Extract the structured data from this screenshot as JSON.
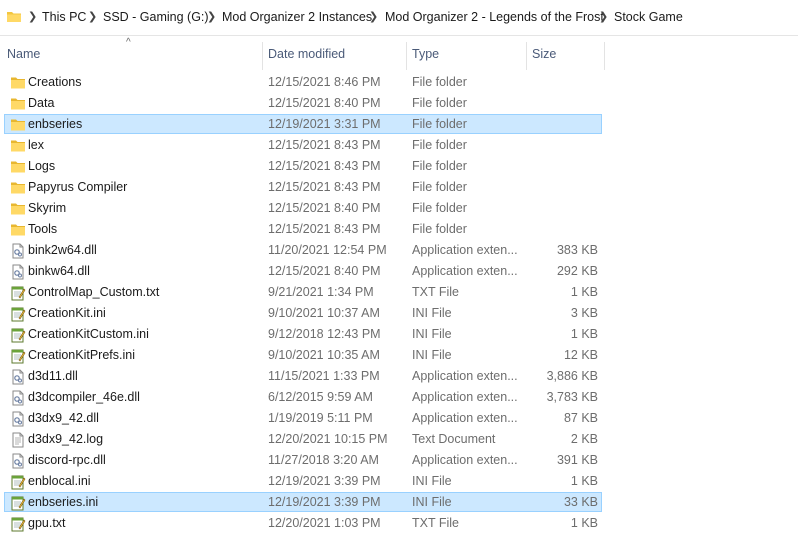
{
  "breadcrumb": [
    "This PC",
    "SSD - Gaming (G:)",
    "Mod Organizer 2 Instances",
    "Mod Organizer 2 - Legends of the Frost",
    "Stock Game"
  ],
  "columns": {
    "name": "Name",
    "date": "Date modified",
    "type": "Type",
    "size": "Size"
  },
  "files": [
    {
      "name": "Creations",
      "date": "12/15/2021 8:46 PM",
      "type": "File folder",
      "size": "",
      "icon": "folder-icon",
      "selected": false
    },
    {
      "name": "Data",
      "date": "12/15/2021 8:40 PM",
      "type": "File folder",
      "size": "",
      "icon": "folder-icon",
      "selected": false
    },
    {
      "name": "enbseries",
      "date": "12/19/2021 3:31 PM",
      "type": "File folder",
      "size": "",
      "icon": "folder-icon",
      "selected": true
    },
    {
      "name": "lex",
      "date": "12/15/2021 8:43 PM",
      "type": "File folder",
      "size": "",
      "icon": "folder-icon",
      "selected": false
    },
    {
      "name": "Logs",
      "date": "12/15/2021 8:43 PM",
      "type": "File folder",
      "size": "",
      "icon": "folder-icon",
      "selected": false
    },
    {
      "name": "Papyrus Compiler",
      "date": "12/15/2021 8:43 PM",
      "type": "File folder",
      "size": "",
      "icon": "folder-icon",
      "selected": false
    },
    {
      "name": "Skyrim",
      "date": "12/15/2021 8:40 PM",
      "type": "File folder",
      "size": "",
      "icon": "folder-icon",
      "selected": false
    },
    {
      "name": "Tools",
      "date": "12/15/2021 8:43 PM",
      "type": "File folder",
      "size": "",
      "icon": "folder-icon",
      "selected": false
    },
    {
      "name": "bink2w64.dll",
      "date": "11/20/2021 12:54 PM",
      "type": "Application exten...",
      "size": "383 KB",
      "icon": "dll-file-icon",
      "selected": false
    },
    {
      "name": "binkw64.dll",
      "date": "12/15/2021 8:40 PM",
      "type": "Application exten...",
      "size": "292 KB",
      "icon": "dll-file-icon",
      "selected": false
    },
    {
      "name": "ControlMap_Custom.txt",
      "date": "9/21/2021 1:34 PM",
      "type": "TXT File",
      "size": "1 KB",
      "icon": "notepad-file-icon",
      "selected": false
    },
    {
      "name": "CreationKit.ini",
      "date": "9/10/2021 10:37 AM",
      "type": "INI File",
      "size": "3 KB",
      "icon": "notepad-file-icon",
      "selected": false
    },
    {
      "name": "CreationKitCustom.ini",
      "date": "9/12/2018 12:43 PM",
      "type": "INI File",
      "size": "1 KB",
      "icon": "notepad-file-icon",
      "selected": false
    },
    {
      "name": "CreationKitPrefs.ini",
      "date": "9/10/2021 10:35 AM",
      "type": "INI File",
      "size": "12 KB",
      "icon": "notepad-file-icon",
      "selected": false
    },
    {
      "name": "d3d11.dll",
      "date": "11/15/2021 1:33 PM",
      "type": "Application exten...",
      "size": "3,886 KB",
      "icon": "dll-file-icon",
      "selected": false
    },
    {
      "name": "d3dcompiler_46e.dll",
      "date": "6/12/2015 9:59 AM",
      "type": "Application exten...",
      "size": "3,783 KB",
      "icon": "dll-file-icon",
      "selected": false
    },
    {
      "name": "d3dx9_42.dll",
      "date": "1/19/2019 5:11 PM",
      "type": "Application exten...",
      "size": "87 KB",
      "icon": "dll-file-icon",
      "selected": false
    },
    {
      "name": "d3dx9_42.log",
      "date": "12/20/2021 10:15 PM",
      "type": "Text Document",
      "size": "2 KB",
      "icon": "text-file-icon",
      "selected": false
    },
    {
      "name": "discord-rpc.dll",
      "date": "11/27/2018 3:20 AM",
      "type": "Application exten...",
      "size": "391 KB",
      "icon": "dll-file-icon",
      "selected": false
    },
    {
      "name": "enblocal.ini",
      "date": "12/19/2021 3:39 PM",
      "type": "INI File",
      "size": "1 KB",
      "icon": "notepad-file-icon",
      "selected": false
    },
    {
      "name": "enbseries.ini",
      "date": "12/19/2021 3:39 PM",
      "type": "INI File",
      "size": "33 KB",
      "icon": "notepad-file-icon",
      "selected": true
    },
    {
      "name": "gpu.txt",
      "date": "12/20/2021 1:03 PM",
      "type": "TXT File",
      "size": "1 KB",
      "icon": "notepad-file-icon",
      "selected": false
    }
  ],
  "colors": {
    "selection_bg": "#cce8ff",
    "selection_border": "#99d1ff",
    "folder_yellow": "#ffd966",
    "header_text": "#4a5a78"
  }
}
